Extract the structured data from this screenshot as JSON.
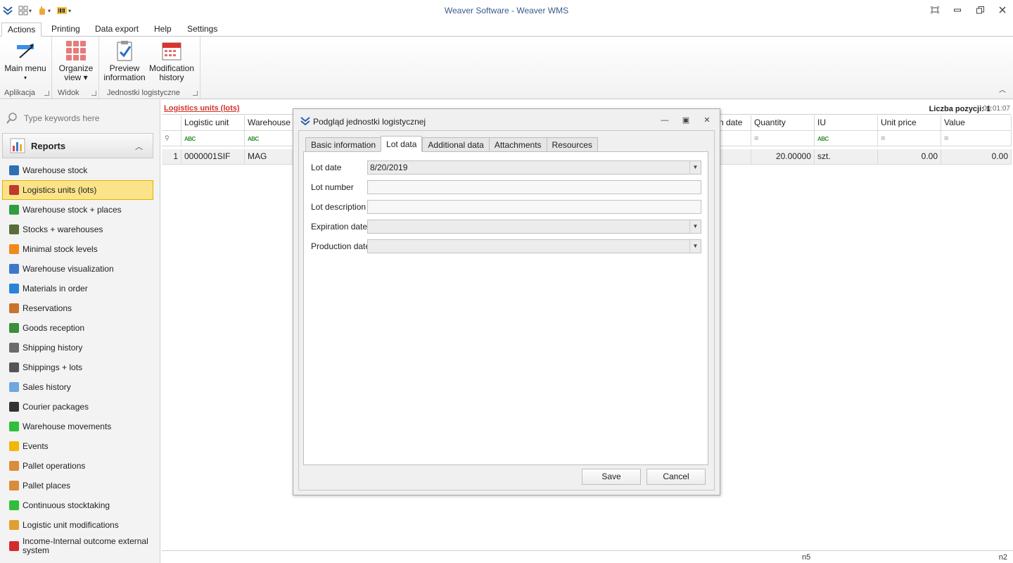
{
  "window": {
    "title": "Weaver Software - Weaver WMS"
  },
  "ribbon": {
    "tabs": [
      "Actions",
      "Printing",
      "Data export",
      "Help",
      "Settings"
    ],
    "groups": [
      {
        "caption": "Aplikacja",
        "buttons": [
          {
            "label_line1": "Main menu",
            "label_line2": "▾"
          }
        ]
      },
      {
        "caption": "Widok",
        "buttons": [
          {
            "label_line1": "Organize",
            "label_line2": "view ▾"
          }
        ]
      },
      {
        "caption": "Jednostki logistyczne",
        "buttons": [
          {
            "label_line1": "Preview",
            "label_line2": "information"
          },
          {
            "label_line1": "Modification",
            "label_line2": "history"
          }
        ]
      }
    ]
  },
  "sidebar": {
    "search_placeholder": "Type keywords here",
    "section": "Reports",
    "items": [
      {
        "label": "Warehouse stock",
        "icon": "warehouse-stock-icon",
        "color": "#2f6db5"
      },
      {
        "label": "Logistics units (lots)",
        "icon": "logistic-units-icon",
        "color": "#c0392b",
        "selected": true
      },
      {
        "label": "Warehouse stock + places",
        "icon": "stock-places-icon",
        "color": "#2e9e3e"
      },
      {
        "label": "Stocks + warehouses",
        "icon": "stocks-warehouses-icon",
        "color": "#5a6e3a"
      },
      {
        "label": "Minimal stock levels",
        "icon": "arrow-down-icon",
        "color": "#f08a1c"
      },
      {
        "label": "Warehouse visualization",
        "icon": "map-icon",
        "color": "#3d78c9"
      },
      {
        "label": "Materials in order",
        "icon": "flag-icon",
        "color": "#2b82d9"
      },
      {
        "label": "Reservations",
        "icon": "reservation-icon",
        "color": "#c8742b"
      },
      {
        "label": "Goods reception",
        "icon": "truck-icon",
        "color": "#3b8f3b"
      },
      {
        "label": "Shipping history",
        "icon": "shipping-icon",
        "color": "#6b6b6b"
      },
      {
        "label": "Shippings + lots",
        "icon": "shipping-lots-icon",
        "color": "#555555"
      },
      {
        "label": "Sales history",
        "icon": "sales-icon",
        "color": "#6fa8dc"
      },
      {
        "label": "Courier packages",
        "icon": "plane-icon",
        "color": "#333333"
      },
      {
        "label": "Warehouse movements",
        "icon": "arrow-right-icon",
        "color": "#2fbf3a"
      },
      {
        "label": "Events",
        "icon": "lightning-icon",
        "color": "#f2b705"
      },
      {
        "label": "Pallet operations",
        "icon": "pallet-icon",
        "color": "#d98c3a"
      },
      {
        "label": "Pallet places",
        "icon": "pallet-places-icon",
        "color": "#d98c3a"
      },
      {
        "label": "Continuous stocktaking",
        "icon": "refresh-icon",
        "color": "#2fbf3a"
      },
      {
        "label": "Logistic unit modifications",
        "icon": "edit-icon",
        "color": "#e0a030"
      },
      {
        "label_line1": "Income-Internal outcome external",
        "label_line2": "system",
        "icon": "exchange-icon",
        "color": "#d42b2b"
      }
    ]
  },
  "main": {
    "title": "Logistics units (lots)",
    "count_label": "Liczba pozycji: 1",
    "timer": "00:01:07",
    "columns": [
      "Logistic unit",
      "Warehouse",
      "n date",
      "Quantity",
      "IU",
      "Unit price",
      "Value"
    ],
    "filter_marks": {
      "text": "ABC",
      "numeric": "="
    },
    "rows": [
      {
        "no": "1",
        "logistic_unit": "0000001SIF",
        "warehouse": "MAG",
        "quantity": "20.00000",
        "iu": "szt.",
        "unit_price": "0.00",
        "value": "0.00"
      }
    ],
    "status_left": "n5",
    "status_right": "n2"
  },
  "dialog": {
    "title": "Podgląd jednostki logistycznej",
    "tabs": [
      "Basic information",
      "Lot data",
      "Additional data",
      "Attachments",
      "Resources"
    ],
    "active_tab": "Lot data",
    "fields": [
      {
        "label": "Lot date",
        "value": "8/20/2019"
      },
      {
        "label": "Lot number",
        "value": ""
      },
      {
        "label": "Lot description",
        "value": ""
      },
      {
        "label": "Expiration date",
        "value": ""
      },
      {
        "label": "Production date",
        "value": ""
      }
    ],
    "save_label": "Save",
    "cancel_label": "Cancel"
  }
}
